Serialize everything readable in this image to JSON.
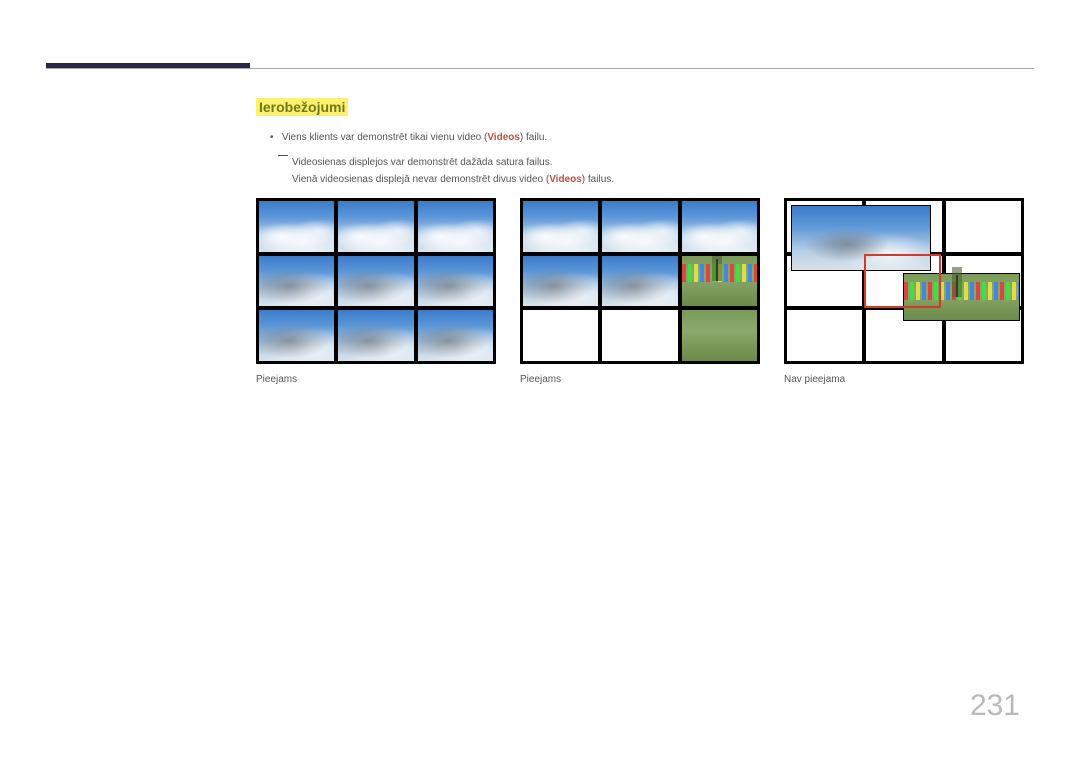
{
  "heading": "Ierobežojumi",
  "bullet1_pre": "Viens klients var demonstrēt tikai vienu video (",
  "bullet1_brand": "Videos",
  "bullet1_post": ") failu.",
  "dash_line1": "Videosienas displejos var demonstrēt dažāda satura failus.",
  "dash_line2_pre": "Vienā videosienas displejā nevar demonstrēt divus video (",
  "dash_line2_brand": "Videos",
  "dash_line2_post": ") failus.",
  "labels": {
    "fig1": "Pieejams",
    "fig2": "Pieejams",
    "fig3": "Nav pieejama"
  },
  "page_number": "231"
}
